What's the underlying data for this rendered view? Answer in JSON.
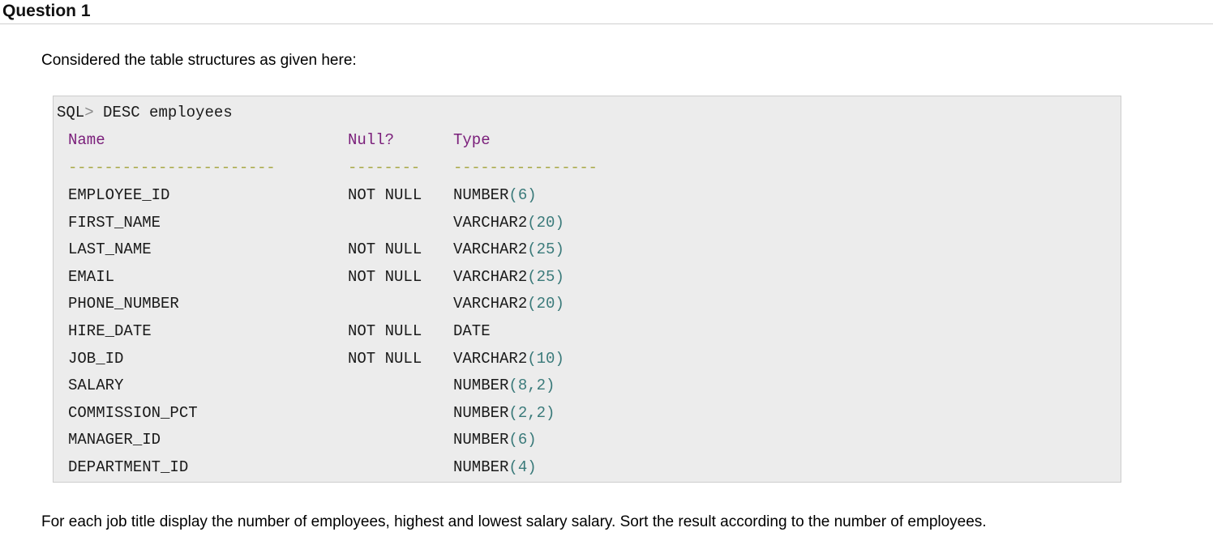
{
  "question": {
    "title": "Question 1",
    "intro": "Considered the table structures as given here:",
    "prompt_text": "For each job title display the number of employees, highest and lowest salary salary. Sort the result according to the number of employees."
  },
  "sql": {
    "prompt": "SQL",
    "prompt_symbol": ">",
    "command": " DESC employees",
    "headers": {
      "name": "Name",
      "null": "Null?",
      "type": "Type"
    },
    "dashes": {
      "name": "-----------------------",
      "null": "--------",
      "type": "----------------"
    },
    "rows": [
      {
        "name": "EMPLOYEE_ID",
        "null": "NOT NULL",
        "type_base": "NUMBER",
        "type_args": "6"
      },
      {
        "name": "FIRST_NAME",
        "null": "",
        "type_base": "VARCHAR2",
        "type_args": "20"
      },
      {
        "name": "LAST_NAME",
        "null": "NOT NULL",
        "type_base": "VARCHAR2",
        "type_args": "25"
      },
      {
        "name": "EMAIL",
        "null": "NOT NULL",
        "type_base": "VARCHAR2",
        "type_args": "25"
      },
      {
        "name": "PHONE_NUMBER",
        "null": "",
        "type_base": "VARCHAR2",
        "type_args": "20"
      },
      {
        "name": "HIRE_DATE",
        "null": "NOT NULL",
        "type_base": "DATE",
        "type_args": ""
      },
      {
        "name": "JOB_ID",
        "null": "NOT NULL",
        "type_base": "VARCHAR2",
        "type_args": "10"
      },
      {
        "name": "SALARY",
        "null": "",
        "type_base": "NUMBER",
        "type_args": "8,2"
      },
      {
        "name": "COMMISSION_PCT",
        "null": "",
        "type_base": "NUMBER",
        "type_args": "2,2"
      },
      {
        "name": "MANAGER_ID",
        "null": "",
        "type_base": "NUMBER",
        "type_args": "6"
      },
      {
        "name": "DEPARTMENT_ID",
        "null": "",
        "type_base": "NUMBER",
        "type_args": "4"
      }
    ]
  },
  "colors": {
    "header_text": "#7a1e7a",
    "dashes": "#a8a845",
    "numbers": "#3a7a7a",
    "panel_bg": "#ececec"
  }
}
